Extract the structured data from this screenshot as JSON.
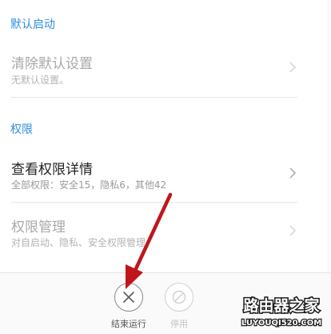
{
  "sections": {
    "default_launch": {
      "header": "默认启动"
    },
    "permissions": {
      "header": "权限"
    }
  },
  "rows": {
    "clear_defaults": {
      "title": "清除默认设置",
      "subtitle": "无默认设置。"
    },
    "view_permissions": {
      "title": "查看权限详情",
      "subtitle": "全部权限：安全15，隐私6，其他42"
    },
    "manage_permissions": {
      "title": "权限管理",
      "subtitle": "对自启动、隐私、安全权限管理"
    }
  },
  "actions": {
    "force_stop": {
      "label": "结束运行"
    },
    "disable": {
      "label": "停用"
    }
  },
  "watermark": {
    "logo_text": "路由器之家",
    "domain": "LUYOUQI520.COM"
  },
  "colors": {
    "section_header": "#2f8fe0",
    "annotation_arrow": "#c0161b"
  }
}
